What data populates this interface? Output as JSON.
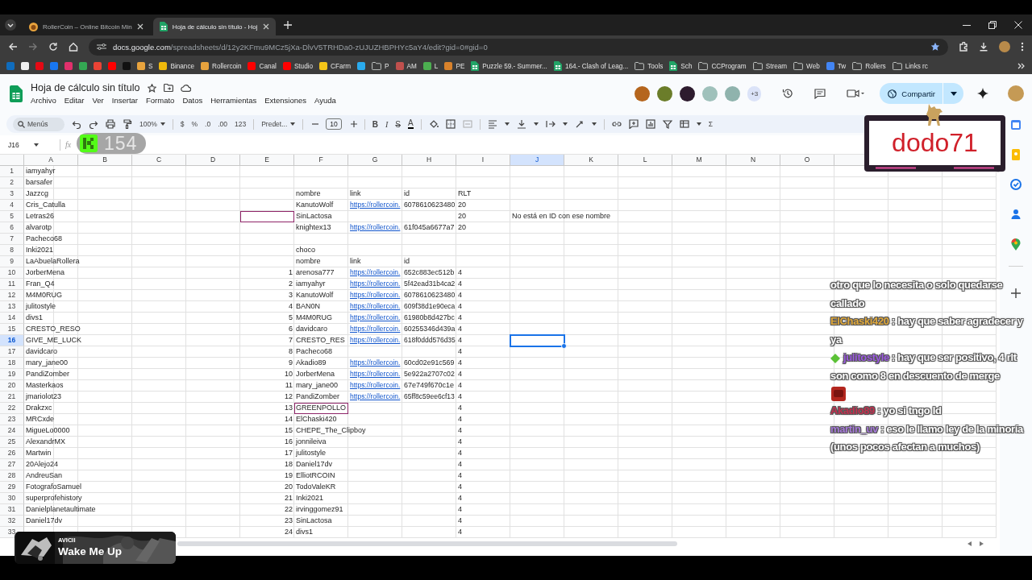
{
  "browser": {
    "tabs": [
      {
        "title": "RollerCoin – Online Bitcoin Min",
        "kind": "site",
        "selected": false
      },
      {
        "title": "Hoja de cálculo sin título - Hoj",
        "kind": "sheet",
        "selected": true
      }
    ],
    "address": {
      "domain": "docs.google.com",
      "path": "/spreadsheets/d/12y2KFmu9MCz5jXa-DlvV5TRHDa0-zUJUZHBPHYc5aY4/edit?gid=0#gid=0"
    },
    "bookmarks": [
      {
        "kind": "site",
        "color": "#0f6cbd"
      },
      {
        "kind": "site",
        "color": "#f1f1f1"
      },
      {
        "kind": "site",
        "color": "#e50914"
      },
      {
        "kind": "site",
        "color": "#1877f2"
      },
      {
        "kind": "site",
        "color": "#e1306c"
      },
      {
        "kind": "site",
        "color": "#34a853"
      },
      {
        "kind": "site",
        "color": "#ea4335"
      },
      {
        "kind": "site",
        "color": "#ff0000"
      },
      {
        "kind": "site",
        "color": "#111111"
      },
      {
        "kind": "site",
        "color": "#e8a33d",
        "label": "S"
      },
      {
        "kind": "site",
        "color": "#f0b90b",
        "label": "Binance"
      },
      {
        "kind": "site",
        "color": "#e8a33d",
        "label": "Rollercoin"
      },
      {
        "kind": "site",
        "color": "#ff0000",
        "label": "Canal"
      },
      {
        "kind": "site",
        "color": "#ff0000",
        "label": "Studio"
      },
      {
        "kind": "site",
        "color": "#f5c518",
        "label": "CFarm"
      },
      {
        "kind": "site",
        "color": "#2aabee"
      },
      {
        "kind": "folder",
        "label": "P"
      },
      {
        "kind": "site",
        "color": "#c0504d",
        "label": "AM"
      },
      {
        "kind": "site",
        "color": "#4caf50",
        "label": "L"
      },
      {
        "kind": "site",
        "color": "#d9822b",
        "label": "PE"
      },
      {
        "kind": "sheet",
        "label": "Puzzle 59.- Summer..."
      },
      {
        "kind": "sheet",
        "label": "164.- Clash of Leag..."
      },
      {
        "kind": "folder",
        "label": "Tools"
      },
      {
        "kind": "sheet",
        "label": "Sch"
      },
      {
        "kind": "folder",
        "label": "CCProgram"
      },
      {
        "kind": "folder",
        "label": "Stream"
      },
      {
        "kind": "folder",
        "label": "Web"
      },
      {
        "kind": "site",
        "color": "#4285f4",
        "label": "Tw"
      },
      {
        "kind": "folder",
        "label": "Rollers"
      },
      {
        "kind": "folder",
        "label": "Links rc"
      }
    ]
  },
  "sheets": {
    "title": "Hoja de cálculo sin título",
    "menu": [
      "Archivo",
      "Editar",
      "Ver",
      "Insertar",
      "Formato",
      "Datos",
      "Herramientas",
      "Extensiones",
      "Ayuda"
    ],
    "collaborators": [
      {
        "color": "#b5651d"
      },
      {
        "color": "#6b7d2a"
      },
      {
        "color": "#2d1b2e"
      },
      {
        "color": "#9fc1bb"
      },
      {
        "color": "#8fb3ad"
      }
    ],
    "more_collaborators": "+3",
    "share": "Compartir",
    "toolbar": {
      "search_placeholder": "Menús",
      "zoom": "100%",
      "currency": "$",
      "percent": "%",
      "decimal_decrease": ".0",
      "decimal_increase": ".00",
      "number_format": "123",
      "font": "Predet...",
      "font_size": "10",
      "bold": "B",
      "italic": "I",
      "strikethrough": "S",
      "text_color": "A",
      "functions": "Σ"
    },
    "name_box": "J16",
    "formula_label": "fx"
  },
  "grid": {
    "columns": [
      {
        "letter": "A"
      },
      {
        "letter": "B"
      },
      {
        "letter": "C"
      },
      {
        "letter": "D"
      },
      {
        "letter": "E",
        "numeric": true
      },
      {
        "letter": "F"
      },
      {
        "letter": "G"
      },
      {
        "letter": "H"
      },
      {
        "letter": "I"
      },
      {
        "letter": "J"
      },
      {
        "letter": "K"
      },
      {
        "letter": "L"
      },
      {
        "letter": "M"
      },
      {
        "letter": "N"
      },
      {
        "letter": "O"
      }
    ],
    "rows": [
      {
        "n": "1",
        "cells": {
          "A": "iamyahyr"
        }
      },
      {
        "n": "2",
        "cells": {
          "A": "barsafer"
        }
      },
      {
        "n": "3",
        "cells": {
          "A": "Jazzcg",
          "F": "nombre",
          "G": "link",
          "H": "id",
          "I": "RLT"
        }
      },
      {
        "n": "4",
        "cells": {
          "A": "Cris_Catulla",
          "F": "KanutoWolf",
          "G": {
            "text": "https://rollercoin.",
            "link": true
          },
          "H": "6078610623480",
          "I": "20"
        }
      },
      {
        "n": "5",
        "cells": {
          "A": "Letras26",
          "E": {
            "outlined": true
          },
          "F": "SinLactosa",
          "I": "20",
          "J": "No está en ID con ese nombre"
        }
      },
      {
        "n": "6",
        "cells": {
          "A": "alvarotp",
          "F": "knightex13",
          "G": {
            "text": "https://rollercoin.",
            "link": true
          },
          "H": "61f045a6677a7",
          "I": "20"
        }
      },
      {
        "n": "7",
        "cells": {
          "A": "Pacheco68"
        }
      },
      {
        "n": "8",
        "cells": {
          "A": "Inki2021",
          "F": "choco"
        }
      },
      {
        "n": "9",
        "cells": {
          "A": "LaAbuelaRollera",
          "F": "nombre",
          "G": "link",
          "H": "id"
        }
      },
      {
        "n": "10",
        "cells": {
          "A": "JorberMena",
          "E": "1",
          "F": "arenosa777",
          "G": {
            "text": "https://rollercoin.",
            "link": true
          },
          "H": "652c883ec512b",
          "I": "4"
        }
      },
      {
        "n": "11",
        "cells": {
          "A": "Fran_Q4",
          "E": "2",
          "F": "iamyahyr",
          "G": {
            "text": "https://rollercoin.",
            "link": true
          },
          "H": "5f42ead31b4ca2",
          "I": "4"
        }
      },
      {
        "n": "12",
        "cells": {
          "A": "M4M0RUG",
          "E": "3",
          "F": "KanutoWolf",
          "G": {
            "text": "https://rollercoin.",
            "link": true
          },
          "H": "6078610623480",
          "I": "4"
        }
      },
      {
        "n": "13",
        "cells": {
          "A": "julitostyle",
          "E": "4",
          "F": "BAN0N",
          "G": {
            "text": "https://rollercoin.",
            "link": true
          },
          "H": "609f38d1e90eca",
          "I": "4"
        }
      },
      {
        "n": "14",
        "cells": {
          "A": "divs1",
          "E": "5",
          "F": "M4M0RUG",
          "G": {
            "text": "https://rollercoin.",
            "link": true
          },
          "H": "61980b8d427bc",
          "I": "4"
        }
      },
      {
        "n": "15",
        "cells": {
          "A": "CRESTO_RESO",
          "E": "6",
          "F": "davidcaro",
          "G": {
            "text": "https://rollercoin.",
            "link": true
          },
          "H": "60255346d439a",
          "I": "4"
        }
      },
      {
        "n": "16",
        "cells": {
          "A": "GIVE_ME_LUCK",
          "E": "7",
          "F": "CRESTO_RES",
          "G": {
            "text": "https://rollercoin.",
            "link": true
          },
          "H": "618f0ddd576d35",
          "I": "4",
          "J": {
            "selected": true
          }
        }
      },
      {
        "n": "17",
        "cells": {
          "A": "davidcaro",
          "E": "8",
          "F": "Pacheco68",
          "I": "4"
        }
      },
      {
        "n": "18",
        "cells": {
          "A": "mary_jane00",
          "E": "9",
          "F": "Akadio89",
          "G": {
            "text": "https://rollercoin.",
            "link": true
          },
          "H": "60cd02e91c569",
          "I": "4"
        }
      },
      {
        "n": "19",
        "cells": {
          "A": "PandiZomber",
          "E": "10",
          "F": "JorberMena",
          "G": {
            "text": "https://rollercoin.",
            "link": true
          },
          "H": "5e922a2707c02",
          "I": "4"
        }
      },
      {
        "n": "20",
        "cells": {
          "A": "Masterkaos",
          "E": "11",
          "F": "mary_jane00",
          "G": {
            "text": "https://rollercoin.",
            "link": true
          },
          "H": "67e749f670c1e",
          "I": "4"
        }
      },
      {
        "n": "21",
        "cells": {
          "A": "jmariolot23",
          "E": "12",
          "F": "PandiZomber",
          "G": {
            "text": "https://rollercoin.",
            "link": true
          },
          "H": "65ff8c59ee6cf13",
          "I": "4"
        }
      },
      {
        "n": "22",
        "cells": {
          "A": "Drakzxc",
          "E": "13",
          "F": {
            "text": "GREENPOLLO",
            "outlined": true
          },
          "I": "4"
        }
      },
      {
        "n": "23",
        "cells": {
          "A": "MRCxde",
          "E": "14",
          "F": "ElChaski420",
          "I": "4"
        }
      },
      {
        "n": "24",
        "cells": {
          "A": "MigueLo0000",
          "E": "15",
          "F": "CHEPE_The_Clipboy",
          "I": "4"
        }
      },
      {
        "n": "25",
        "cells": {
          "A": "AlexandrMX",
          "E": "16",
          "F": "jonnileiva",
          "I": "4"
        }
      },
      {
        "n": "26",
        "cells": {
          "A": "Martwin",
          "E": "17",
          "F": "julitostyle",
          "I": "4"
        }
      },
      {
        "n": "27",
        "cells": {
          "A": "20Alejo24",
          "E": "18",
          "F": "Daniel17dv",
          "I": "4"
        }
      },
      {
        "n": "28",
        "cells": {
          "A": "AndreuSan",
          "E": "19",
          "F": "ElliotRCOIN",
          "I": "4"
        }
      },
      {
        "n": "29",
        "cells": {
          "A": "FotografoSamuel",
          "E": "20",
          "F": "TodoValeKR",
          "I": "4"
        }
      },
      {
        "n": "30",
        "cells": {
          "A": "superprofehistory",
          "E": "21",
          "F": "Inki2021",
          "I": "4"
        }
      },
      {
        "n": "31",
        "cells": {
          "A": "Danielplanetaultimate",
          "E": "22",
          "F": "irvinggomez91",
          "I": "4"
        }
      },
      {
        "n": "32",
        "cells": {
          "A": "Daniel17dv",
          "E": "23",
          "F": "SinLactosa",
          "I": "4"
        }
      },
      {
        "n": "33",
        "cells": {
          "E": "24",
          "F": "divs1",
          "I": "4"
        }
      }
    ]
  },
  "overlay": {
    "counter": "154",
    "streamer": "dodo71",
    "chat": [
      {
        "text": "otro que lo necesita o solo quedarse callado"
      },
      {
        "user": "ElChaski420",
        "color": "#e0a83a",
        "text": ": hay que saber agradecer y ya"
      },
      {
        "badge": true,
        "user": "julitostyle",
        "color": "#9b59e0",
        "text": ": hay que ser positivo, 4 rlt son como 8 en descuento de merge",
        "emote": true
      },
      {
        "user": "Akadio89",
        "color": "#c2304f",
        "text": ": yo si tngo Id"
      },
      {
        "user": "martin_uv",
        "color": "#a67ad9",
        "text": ": eso le llamo ley de la minoría (unos pocos afectan a muchos)"
      }
    ],
    "now_playing": {
      "artist": "AVICII",
      "title": "Wake Me Up"
    }
  }
}
